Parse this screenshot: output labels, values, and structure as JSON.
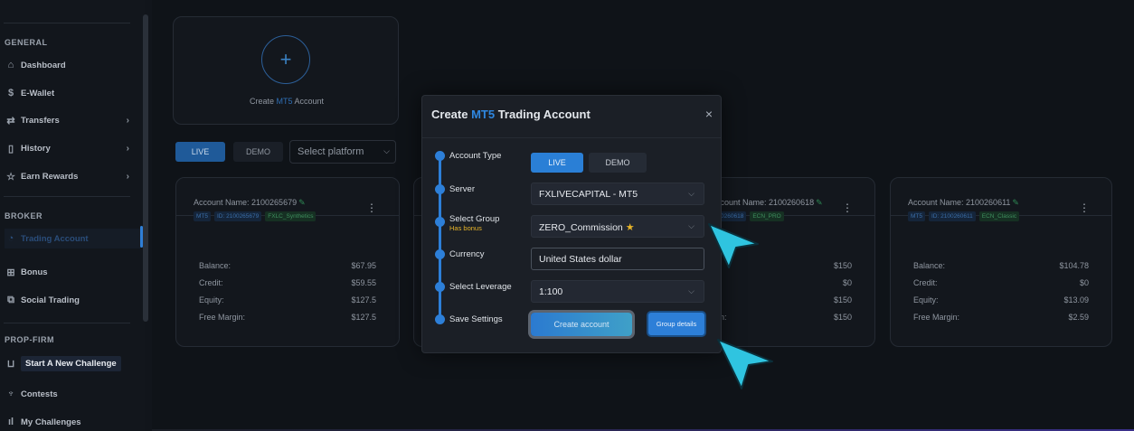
{
  "sidebar": {
    "sections": {
      "general": "GENERAL",
      "broker": "BROKER",
      "prop_firm": "PROP-FIRM"
    },
    "items": [
      {
        "label": "Dashboard",
        "icon": "home-icon"
      },
      {
        "label": "E-Wallet",
        "icon": "dollar-icon"
      },
      {
        "label": "Transfers",
        "icon": "transfer-icon"
      },
      {
        "label": "History",
        "icon": "book-icon"
      },
      {
        "label": "Earn Rewards",
        "icon": "star-icon"
      },
      {
        "label": "Trading Account",
        "icon": "chart-icon"
      },
      {
        "label": "Bonus",
        "icon": "gift-icon"
      },
      {
        "label": "Social Trading",
        "icon": "copy-icon"
      },
      {
        "label": "Start A New Challenge",
        "icon": "cart-icon"
      },
      {
        "label": "Contests",
        "icon": "trophy-icon"
      },
      {
        "label": "My Challenges",
        "icon": "bar-chart-icon"
      }
    ]
  },
  "main": {
    "create_card": {
      "prefix": "Create ",
      "platform": "MT5",
      "suffix": " Account"
    },
    "tabs": {
      "live": "LIVE",
      "demo": "DEMO"
    },
    "platform_placeholder": "Select platform",
    "accounts": [
      {
        "name": "Account Name: 2100265679",
        "tags": [
          "MT5",
          "ID: 2100265679",
          "FXLC_Synthetics"
        ],
        "rows": [
          {
            "label": "Balance:",
            "value": "$67.95"
          },
          {
            "label": "Credit:",
            "value": "$59.55"
          },
          {
            "label": "Equity:",
            "value": "$127.5"
          },
          {
            "label": "Free Margin:",
            "value": "$127.5"
          }
        ]
      },
      {
        "name": "Account Name: 2100260618",
        "tags": [
          "0260618",
          "ECN_PRO"
        ],
        "rows": [
          {
            "label": "",
            "value": "$150"
          },
          {
            "label": "",
            "value": "$0"
          },
          {
            "label": "",
            "value": "$150"
          },
          {
            "label": "n:",
            "value": "$150"
          }
        ]
      },
      {
        "name": "Account Name: 2100260611",
        "tags": [
          "MT5",
          "ID: 2100260611",
          "ECN_Classic"
        ],
        "rows": [
          {
            "label": "Balance:",
            "value": "$104.78"
          },
          {
            "label": "Credit:",
            "value": "$0"
          },
          {
            "label": "Equity:",
            "value": "$13.09"
          },
          {
            "label": "Free Margin:",
            "value": "$2.59"
          }
        ]
      }
    ]
  },
  "modal": {
    "title_prefix": "Create ",
    "title_platform": "MT5",
    "title_suffix": " Trading Account",
    "close": "×",
    "steps": {
      "account_type": "Account Type",
      "server": "Server",
      "select_group": "Select Group",
      "has_bonus": "Has bonus",
      "currency": "Currency",
      "select_leverage": "Select Leverage",
      "save_settings": "Save Settings"
    },
    "account_type": {
      "live": "LIVE",
      "demo": "DEMO"
    },
    "server_value": "FXLIVECAPITAL - MT5",
    "group_value": "ZERO_Commission",
    "currency_value": "United States dollar",
    "leverage_value": "1:100",
    "create_button": "Create account",
    "details_button": "Group details"
  },
  "colors": {
    "accent": "#2d7fd8",
    "bonus": "#e7b429",
    "background": "#11151b",
    "cursor": "#2fc4e0"
  }
}
